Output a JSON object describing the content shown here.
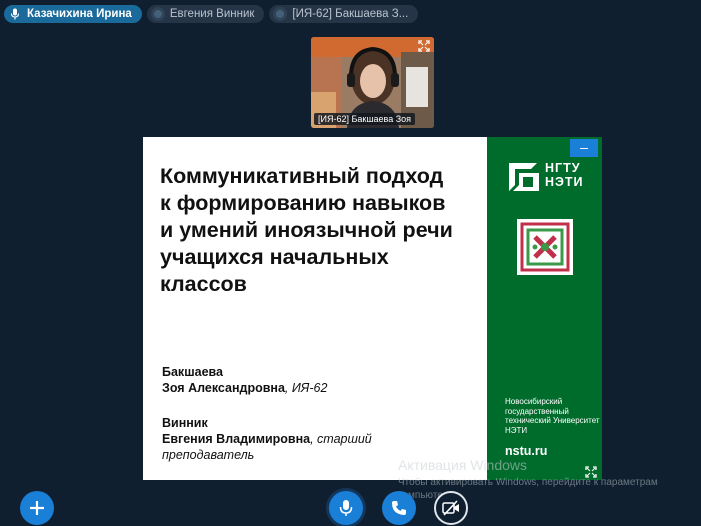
{
  "participants": [
    {
      "name": "Казачихина Ирина",
      "state": "active",
      "icon": "mic-icon"
    },
    {
      "name": "Евгения Винник",
      "state": "muted",
      "icon": "participant-dot-icon"
    },
    {
      "name": "[ИЯ-62] Бакшаева З...",
      "state": "muted",
      "icon": "participant-dot-icon"
    }
  ],
  "webcam": {
    "label": "[ИЯ-62] Бакшаева Зоя",
    "expand_icon": "expand-icon"
  },
  "slide": {
    "title_lines": [
      "Коммуникативный подход",
      "к формированию навыков",
      "и умений иноязычной речи",
      "учащихся начальных",
      "классов"
    ],
    "author1": {
      "line1": "Бакшаева",
      "name": "Зоя Александровна",
      "suffix": ", ИЯ-62"
    },
    "author2": {
      "line1": "Винник",
      "name": "Евгения Владимировна",
      "suffix": ", старший",
      "line3": "преподаватель"
    },
    "minimize_label": "–",
    "logo_text": "НГТУ\nНЭТИ",
    "university": "Новосибирский государственный технический Университет НЭТИ",
    "site": "nstu.ru",
    "green_color": "#006c2c"
  },
  "watermark": {
    "title": "Активация Windows",
    "subtitle": "Чтобы активировать Windows, перейдите к параметрам компьютера."
  },
  "controls": {
    "add_icon": "plus-icon",
    "mic_icon": "mic-icon",
    "phone_icon": "phone-icon",
    "camera_icon": "camera-off-icon",
    "accent": "#1a7fd6"
  }
}
